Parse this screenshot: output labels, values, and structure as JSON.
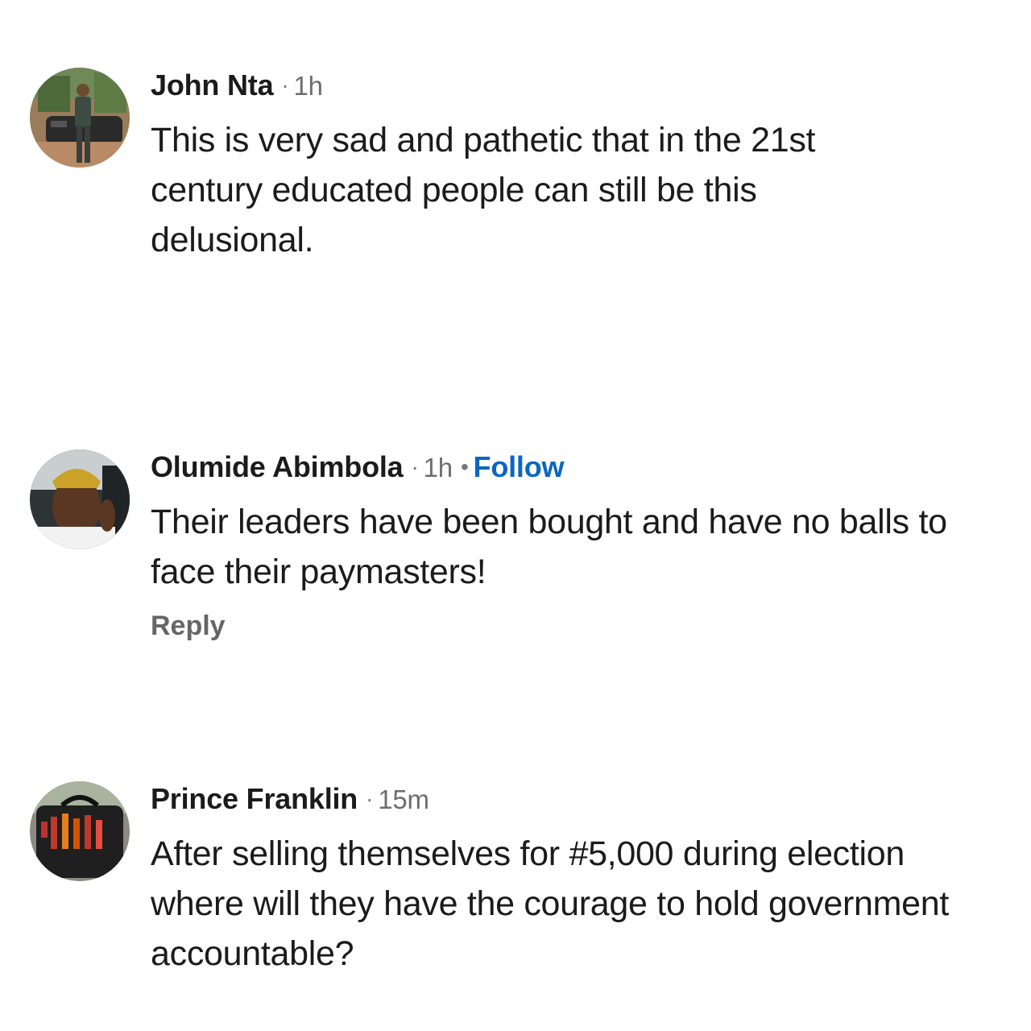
{
  "comments": [
    {
      "author": "John Nta",
      "separator": "·",
      "time": "1h",
      "text": "This is very sad and pathetic that in the 21st century educated people can still be this delusional.",
      "avatar_icon": "profile-photo-man-with-car"
    },
    {
      "author": "Olumide Abimbola",
      "separator": "·",
      "time": "1h",
      "follow_separator": "•",
      "follow_label": "Follow",
      "text": "Their leaders have been bought and have no balls to face their paymasters!",
      "reply_label": "Reply",
      "avatar_icon": "profile-photo-man-in-car"
    },
    {
      "author": "Prince Franklin",
      "separator": "·",
      "time": "15m",
      "text": "After selling themselves for #5,000 during election where will they have the courage to hold government accountable?",
      "avatar_icon": "profile-photo-tool-bag"
    }
  ],
  "colors": {
    "text": "#1b1b1b",
    "muted": "#6e6e6e",
    "link": "#0a66c2"
  }
}
